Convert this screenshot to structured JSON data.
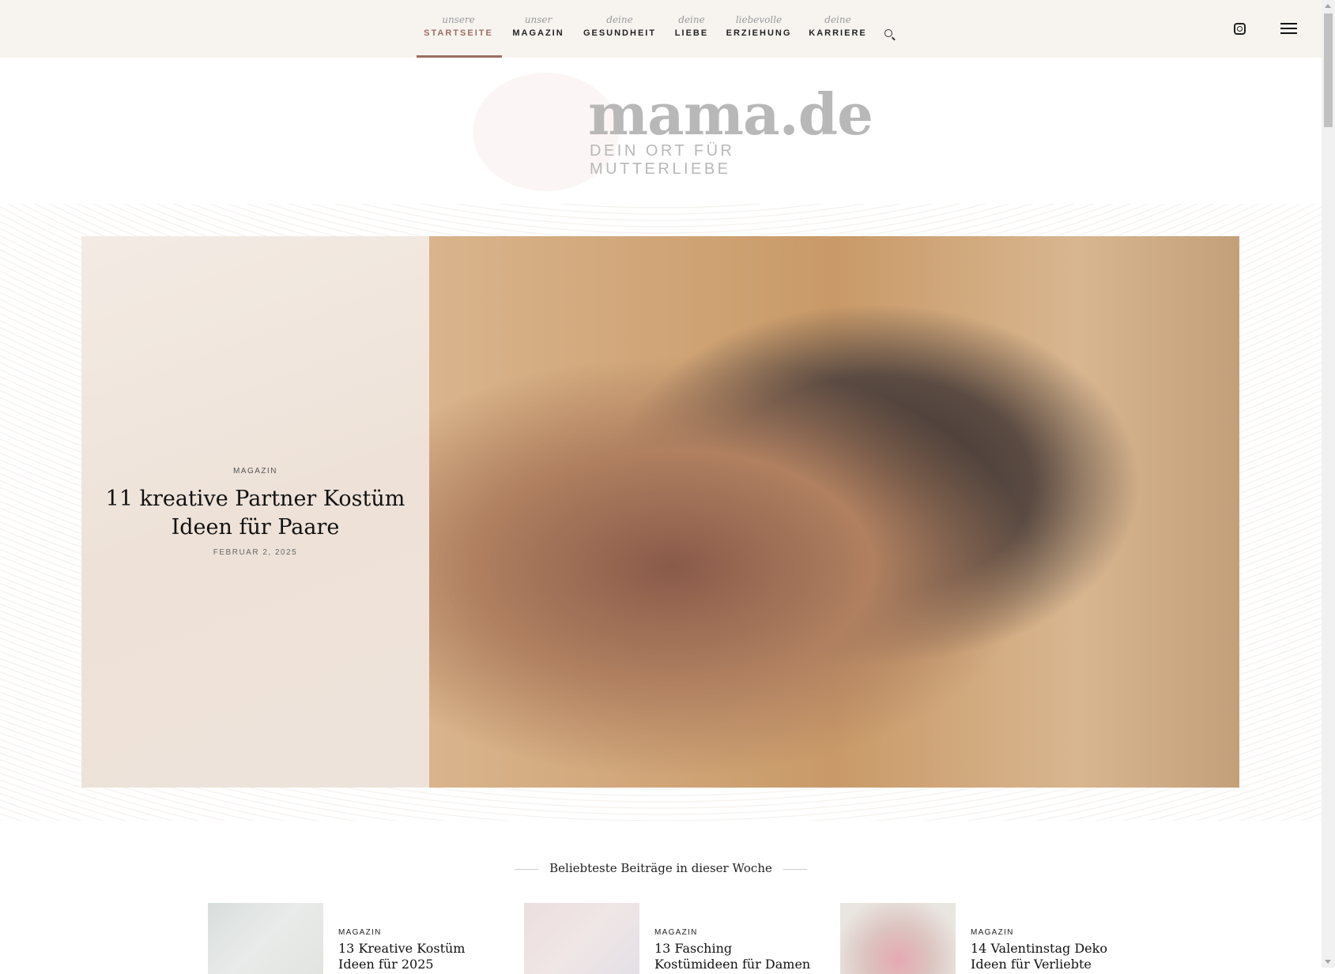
{
  "nav": [
    {
      "sub": "unsere",
      "label": "STARTSEITE",
      "active": true
    },
    {
      "sub": "unser",
      "label": "MAGAZIN"
    },
    {
      "sub": "deine",
      "label": "GESUNDHEIT"
    },
    {
      "sub": "deine",
      "label": "LIEBE"
    },
    {
      "sub": "liebevolle",
      "label": "ERZIEHUNG"
    },
    {
      "sub": "deine",
      "label": "KARRIERE"
    }
  ],
  "icons": {
    "search": "search-icon",
    "social": "instagram-icon",
    "menu": "hamburger-menu-icon"
  },
  "logo": {
    "word": "mama.de",
    "tagline": "DEIN ORT FÜR MUTTERLIEBE"
  },
  "hero": {
    "category": "MAGAZIN",
    "title": "11 kreative Partner Kostüm Ideen für Paare",
    "date": "FEBRUAR 2, 2025"
  },
  "popular": {
    "heading": "Beliebteste Beiträge in dieser Woche",
    "items": [
      {
        "category": "MAGAZIN",
        "title": "13 Kreative Kostüm Ideen für 2025"
      },
      {
        "category": "MAGAZIN",
        "title": "13 Fasching Kostümideen für Damen"
      },
      {
        "category": "MAGAZIN",
        "title": "14 Valentinstag Deko Ideen für Verliebte"
      }
    ]
  },
  "colors": {
    "accent": "#9c6e63",
    "header_bg": "#f7f4f0"
  }
}
